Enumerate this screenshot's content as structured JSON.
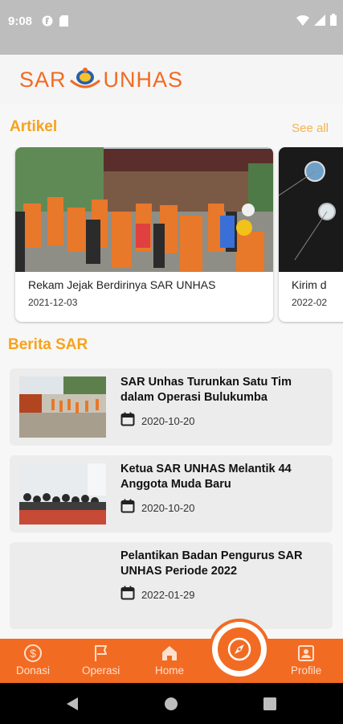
{
  "status": {
    "time": "9:08"
  },
  "header": {
    "logo_left": "SAR",
    "logo_right": "UNHAS"
  },
  "artikel": {
    "heading": "Artikel",
    "see_all": "See all",
    "cards": [
      {
        "title": "Rekam Jejak Berdirinya SAR UNHAS",
        "date": "2021-12-03"
      },
      {
        "title": "Kirim d",
        "date": "2022-02"
      }
    ]
  },
  "berita": {
    "heading": "Berita SAR",
    "items": [
      {
        "title": "SAR Unhas Turunkan Satu Tim dalam Operasi Bulukumba",
        "date": "2020-10-20"
      },
      {
        "title": "Ketua SAR UNHAS Melantik 44 Anggota Muda Baru",
        "date": "2020-10-20"
      },
      {
        "title": "Pelantikan Badan Pengurus SAR UNHAS Periode 2022",
        "date": "2022-01-29"
      }
    ]
  },
  "nav": {
    "donasi": "Donasi",
    "operasi": "Operasi",
    "home": "Home",
    "profile": "Profile"
  },
  "colors": {
    "accent": "#f26b22",
    "heading": "#f7a21b"
  }
}
